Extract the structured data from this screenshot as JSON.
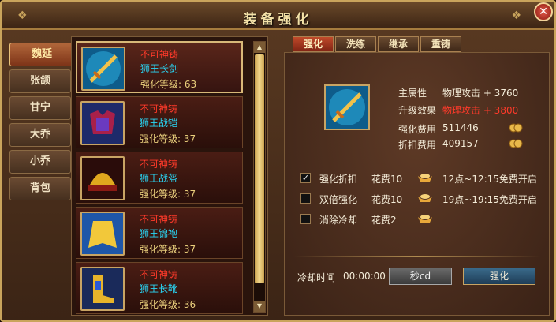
{
  "window": {
    "title": "装备强化",
    "close_label": "✕"
  },
  "characters": [
    {
      "name": "魏延",
      "active": true
    },
    {
      "name": "张颌",
      "active": false
    },
    {
      "name": "甘宁",
      "active": false
    },
    {
      "name": "大乔",
      "active": false
    },
    {
      "name": "小乔",
      "active": false
    },
    {
      "name": "背包",
      "active": false
    }
  ],
  "equipment": [
    {
      "tag": "不可神铸",
      "name": "狮王长剑",
      "level_text": "强化等级: 63",
      "icon": "sword-icon",
      "selected": true
    },
    {
      "tag": "不可神铸",
      "name": "狮王战铠",
      "level_text": "强化等级: 37",
      "icon": "armor-icon",
      "selected": false
    },
    {
      "tag": "不可神铸",
      "name": "狮王战盔",
      "level_text": "强化等级: 37",
      "icon": "helmet-icon",
      "selected": false
    },
    {
      "tag": "不可神铸",
      "name": "狮王锦袍",
      "level_text": "强化等级: 37",
      "icon": "cape-icon",
      "selected": false
    },
    {
      "tag": "不可神铸",
      "name": "狮王长靴",
      "level_text": "强化等级: 36",
      "icon": "boots-icon",
      "selected": false
    }
  ],
  "tabs": [
    {
      "label": "强化",
      "active": true
    },
    {
      "label": "洗练",
      "active": false
    },
    {
      "label": "继承",
      "active": false
    },
    {
      "label": "重铸",
      "active": false
    }
  ],
  "detail": {
    "main_attr_label": "主属性",
    "main_attr_value": "物理攻击 + 3760",
    "upgrade_label": "升级效果",
    "upgrade_value": "物理攻击 + 3800",
    "cost_label": "强化费用",
    "cost_value": "511446",
    "discount_label": "折扣费用",
    "discount_value": "409157"
  },
  "options": [
    {
      "label": "强化折扣",
      "checked": true,
      "cost": "花费10",
      "free": "12点~12:15免费开启"
    },
    {
      "label": "双倍强化",
      "checked": false,
      "cost": "花费10",
      "free": "19点~19:15免费开启"
    },
    {
      "label": "消除冷却",
      "checked": false,
      "cost": "花费2",
      "free": ""
    }
  ],
  "cooldown": {
    "label": "冷却时间",
    "value": "00:00:00"
  },
  "buttons": {
    "instant": "秒cd",
    "upgrade": "强化"
  },
  "colors": {
    "tag_red": "#ff3a2a",
    "name_cyan": "#29d6f5",
    "level_gold": "#e9cf7c",
    "frame_gold": "#c9a45c"
  }
}
